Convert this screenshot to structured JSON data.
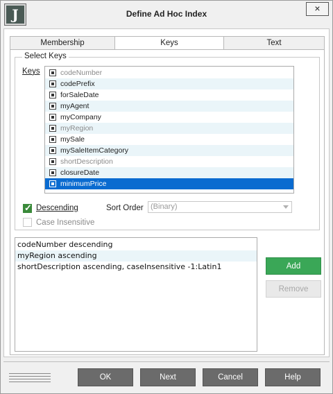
{
  "window": {
    "title": "Define Ad Hoc Index",
    "app_icon_letter": "J",
    "close_glyph": "×"
  },
  "tabs": [
    {
      "label": "Membership"
    },
    {
      "label": "Keys"
    },
    {
      "label": "Text"
    }
  ],
  "select_keys": {
    "legend": "Select Keys",
    "keys_label": "Keys",
    "items": [
      {
        "label": "codeNumber",
        "state": "greyed"
      },
      {
        "label": "codePrefix",
        "state": "highlight"
      },
      {
        "label": "forSaleDate",
        "state": "normal"
      },
      {
        "label": "myAgent",
        "state": "highlight"
      },
      {
        "label": "myCompany",
        "state": "normal"
      },
      {
        "label": "myRegion",
        "state": "greyed-highlight"
      },
      {
        "label": "mySale",
        "state": "normal"
      },
      {
        "label": "mySaleItemCategory",
        "state": "highlight"
      },
      {
        "label": "shortDescription",
        "state": "greyed"
      },
      {
        "label": "closureDate",
        "state": "highlight"
      },
      {
        "label": "minimumPrice",
        "state": "selected"
      }
    ],
    "descending": {
      "label": "Descending",
      "checked": true
    },
    "sort_order": {
      "label": "Sort Order",
      "value": "(Binary)"
    },
    "case_insensitive": {
      "label": "Case Insensitive",
      "checked": false,
      "enabled": false
    }
  },
  "defined_keys": [
    "codeNumber descending",
    "myRegion ascending",
    "shortDescription ascending, caseInsensitive -1:Latin1"
  ],
  "buttons": {
    "add": "Add",
    "remove": "Remove",
    "ok": "OK",
    "next": "Next",
    "cancel": "Cancel",
    "help": "Help"
  },
  "colors": {
    "accent_green": "#3aa757",
    "selection_blue": "#0a6bd0",
    "footer_button": "#6b6b6b"
  }
}
